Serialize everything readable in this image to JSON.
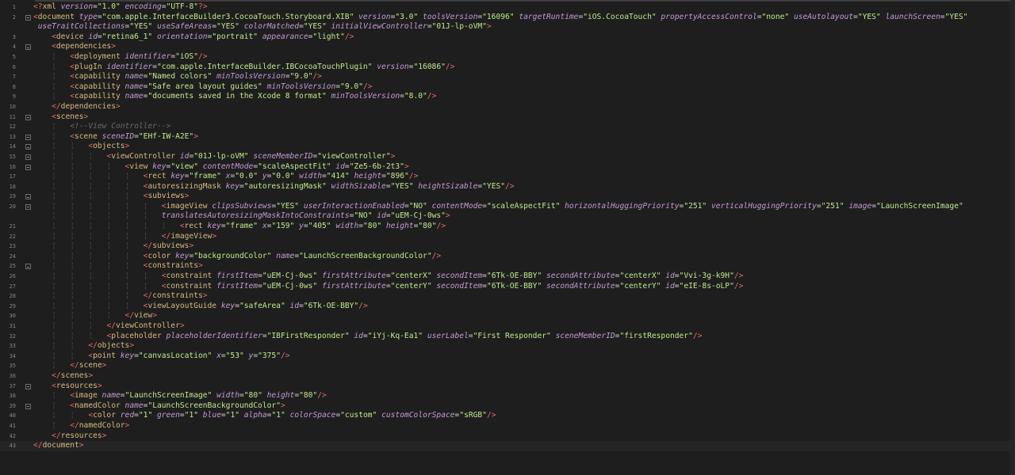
{
  "editor": {
    "lines": [
      {
        "n": "1",
        "fold": false,
        "indent": 1,
        "html": "<span class='punc'>&lt;?</span><span class='tag'>xml</span> <span class='attr'>version</span>=<span class='val'>\"1.0\"</span> <span class='attr'>encoding</span>=<span class='val'>\"UTF-8\"</span><span class='punc'>?&gt;</span>"
      },
      {
        "n": "2",
        "fold": true,
        "indent": 0,
        "html": "<span class='punc'>&lt;</span><span class='tag'>document</span> <span class='attr'>type</span>=<span class='val'>\"com.apple.InterfaceBuilder3.CocoaTouch.Storyboard.XIB\"</span> <span class='attr'>version</span>=<span class='val'>\"3.0\"</span> <span class='attr'>toolsVersion</span>=<span class='val'>\"16096\"</span> <span class='attr'>targetRuntime</span>=<span class='val'>\"iOS.CocoaTouch\"</span> <span class='attr'>propertyAccessControl</span>=<span class='val'>\"none\"</span> <span class='attr'>useAutolayout</span>=<span class='val'>\"YES\"</span> <span class='attr'>launchScreen</span>=<span class='val'>\"YES\"</span>"
      },
      {
        "n": "",
        "fold": false,
        "indent": 0,
        "cont": true,
        "html": " <span class='attr'>useTraitCollections</span>=<span class='val'>\"YES\"</span> <span class='attr'>useSafeAreas</span>=<span class='val'>\"YES\"</span> <span class='attr'>colorMatched</span>=<span class='val'>\"YES\"</span> <span class='attr'>initialViewController</span>=<span class='val'>\"01J-lp-oVM\"</span><span class='punc'>&gt;</span>"
      },
      {
        "n": "3",
        "fold": false,
        "indent": 1,
        "html": "    <span class='punc'>&lt;</span><span class='tag'>device</span> <span class='attr'>id</span>=<span class='val'>\"retina6_1\"</span> <span class='attr'>orientation</span>=<span class='val'>\"portrait\"</span> <span class='attr'>appearance</span>=<span class='val'>\"light\"</span><span class='punc'>/&gt;</span>"
      },
      {
        "n": "4",
        "fold": true,
        "indent": 1,
        "html": "    <span class='punc'>&lt;</span><span class='tag'>dependencies</span><span class='punc'>&gt;</span>"
      },
      {
        "n": "5",
        "fold": false,
        "indent": 2,
        "html": "    <span class='guide'>¦</span>   <span class='punc'>&lt;</span><span class='tag'>deployment</span> <span class='attr'>identifier</span>=<span class='val'>\"iOS\"</span><span class='punc'>/&gt;</span>"
      },
      {
        "n": "6",
        "fold": false,
        "indent": 2,
        "html": "    <span class='guide'>¦</span>   <span class='punc'>&lt;</span><span class='tag'>plugIn</span> <span class='attr'>identifier</span>=<span class='val'>\"com.apple.InterfaceBuilder.IBCocoaTouchPlugin\"</span> <span class='attr'>version</span>=<span class='val'>\"16086\"</span><span class='punc'>/&gt;</span>"
      },
      {
        "n": "7",
        "fold": false,
        "indent": 2,
        "html": "    <span class='guide'>¦</span>   <span class='punc'>&lt;</span><span class='tag'>capability</span> <span class='attr'>name</span>=<span class='val'>\"Named colors\"</span> <span class='attr'>minToolsVersion</span>=<span class='val'>\"9.0\"</span><span class='punc'>/&gt;</span>"
      },
      {
        "n": "8",
        "fold": false,
        "indent": 2,
        "html": "    <span class='guide'>¦</span>   <span class='punc'>&lt;</span><span class='tag'>capability</span> <span class='attr'>name</span>=<span class='val'>\"Safe area layout guides\"</span> <span class='attr'>minToolsVersion</span>=<span class='val'>\"9.0\"</span><span class='punc'>/&gt;</span>"
      },
      {
        "n": "9",
        "fold": false,
        "indent": 2,
        "html": "    <span class='guide'>¦</span>   <span class='punc'>&lt;</span><span class='tag'>capability</span> <span class='attr'>name</span>=<span class='val'>\"documents saved in the Xcode 8 format\"</span> <span class='attr'>minToolsVersion</span>=<span class='val'>\"8.0\"</span><span class='punc'>/&gt;</span>"
      },
      {
        "n": "10",
        "fold": false,
        "indent": 1,
        "html": "    <span class='punc'>&lt;/</span><span class='tag'>dependencies</span><span class='punc'>&gt;</span>"
      },
      {
        "n": "11",
        "fold": true,
        "indent": 1,
        "html": "    <span class='punc'>&lt;</span><span class='tag'>scenes</span><span class='punc'>&gt;</span>"
      },
      {
        "n": "12",
        "fold": false,
        "indent": 2,
        "html": "    <span class='guide'>¦</span>   <span class='cmt'>&lt;!--View Controller--&gt;</span>"
      },
      {
        "n": "13",
        "fold": true,
        "indent": 2,
        "html": "    <span class='guide'>¦</span>   <span class='punc'>&lt;</span><span class='tag'>scene</span> <span class='attr'>sceneID</span>=<span class='val'>\"EHf-IW-A2E\"</span><span class='punc'>&gt;</span>"
      },
      {
        "n": "14",
        "fold": true,
        "indent": 3,
        "html": "    <span class='guide'>¦</span>   <span class='guide'>¦</span>   <span class='punc'>&lt;</span><span class='tag'>objects</span><span class='punc'>&gt;</span>"
      },
      {
        "n": "15",
        "fold": true,
        "indent": 4,
        "html": "    <span class='guide'>¦</span>   <span class='guide'>¦</span>   <span class='guide'>¦</span>   <span class='punc'>&lt;</span><span class='tag'>viewController</span> <span class='attr'>id</span>=<span class='val'>\"01J-lp-oVM\"</span> <span class='attr'>sceneMemberID</span>=<span class='val'>\"viewController\"</span><span class='punc'>&gt;</span>"
      },
      {
        "n": "16",
        "fold": true,
        "indent": 5,
        "html": "    <span class='guide'>¦</span>   <span class='guide'>¦</span>   <span class='guide'>¦</span>   <span class='guide'>¦</span>   <span class='punc'>&lt;</span><span class='tag'>view</span> <span class='attr'>key</span>=<span class='val'>\"view\"</span> <span class='attr'>contentMode</span>=<span class='val'>\"scaleAspectFit\"</span> <span class='attr'>id</span>=<span class='val'>\"Ze5-6b-2t3\"</span><span class='punc'>&gt;</span>"
      },
      {
        "n": "17",
        "fold": false,
        "indent": 6,
        "html": "    <span class='guide'>¦</span>   <span class='guide'>¦</span>   <span class='guide'>¦</span>   <span class='guide'>¦</span>   <span class='guide'>¦</span>   <span class='punc'>&lt;</span><span class='tag'>rect</span> <span class='attr'>key</span>=<span class='val'>\"frame\"</span> <span class='attr'>x</span>=<span class='val'>\"0.0\"</span> <span class='attr'>y</span>=<span class='val'>\"0.0\"</span> <span class='attr'>width</span>=<span class='val'>\"414\"</span> <span class='attr'>height</span>=<span class='val'>\"896\"</span><span class='punc'>/&gt;</span>"
      },
      {
        "n": "18",
        "fold": false,
        "indent": 6,
        "html": "    <span class='guide'>¦</span>   <span class='guide'>¦</span>   <span class='guide'>¦</span>   <span class='guide'>¦</span>   <span class='guide'>¦</span>   <span class='punc'>&lt;</span><span class='tag'>autoresizingMask</span> <span class='attr'>key</span>=<span class='val'>\"autoresizingMask\"</span> <span class='attr'>widthSizable</span>=<span class='val'>\"YES\"</span> <span class='attr'>heightSizable</span>=<span class='val'>\"YES\"</span><span class='punc'>/&gt;</span>"
      },
      {
        "n": "19",
        "fold": true,
        "indent": 6,
        "html": "    <span class='guide'>¦</span>   <span class='guide'>¦</span>   <span class='guide'>¦</span>   <span class='guide'>¦</span>   <span class='guide'>¦</span>   <span class='punc'>&lt;</span><span class='tag'>subviews</span><span class='punc'>&gt;</span>"
      },
      {
        "n": "20",
        "fold": true,
        "indent": 7,
        "html": "    <span class='guide'>¦</span>   <span class='guide'>¦</span>   <span class='guide'>¦</span>   <span class='guide'>¦</span>   <span class='guide'>¦</span>   <span class='guide'>¦</span>   <span class='punc'>&lt;</span><span class='tag'>imageView</span> <span class='attr'>clipsSubviews</span>=<span class='val'>\"YES\"</span> <span class='attr'>userInteractionEnabled</span>=<span class='val'>\"NO\"</span> <span class='attr'>contentMode</span>=<span class='val'>\"scaleAspectFit\"</span> <span class='attr'>horizontalHuggingPriority</span>=<span class='val'>\"251\"</span> <span class='attr'>verticalHuggingPriority</span>=<span class='val'>\"251\"</span> <span class='attr'>image</span>=<span class='val'>\"LaunchScreenImage\"</span>"
      },
      {
        "n": "",
        "fold": false,
        "indent": 7,
        "cont": true,
        "html": "    <span class='guide'>¦</span>   <span class='guide'>¦</span>   <span class='guide'>¦</span>   <span class='guide'>¦</span>   <span class='guide'>¦</span>   <span class='guide'>¦</span>   <span class='attr'>translatesAutoresizingMaskIntoConstraints</span>=<span class='val'>\"NO\"</span> <span class='attr'>id</span>=<span class='val'>\"uEM-Cj-0ws\"</span><span class='punc'>&gt;</span>"
      },
      {
        "n": "21",
        "fold": false,
        "indent": 8,
        "html": "    <span class='guide'>¦</span>   <span class='guide'>¦</span>   <span class='guide'>¦</span>   <span class='guide'>¦</span>   <span class='guide'>¦</span>   <span class='guide'>¦</span>   <span class='guide'>¦</span>   <span class='punc'>&lt;</span><span class='tag'>rect</span> <span class='attr'>key</span>=<span class='val'>\"frame\"</span> <span class='attr'>x</span>=<span class='val'>\"159\"</span> <span class='attr'>y</span>=<span class='val'>\"405\"</span> <span class='attr'>width</span>=<span class='val'>\"80\"</span> <span class='attr'>height</span>=<span class='val'>\"80\"</span><span class='punc'>/&gt;</span>"
      },
      {
        "n": "22",
        "fold": false,
        "indent": 7,
        "html": "    <span class='guide'>¦</span>   <span class='guide'>¦</span>   <span class='guide'>¦</span>   <span class='guide'>¦</span>   <span class='guide'>¦</span>   <span class='guide'>¦</span>   <span class='punc'>&lt;/</span><span class='tag'>imageView</span><span class='punc'>&gt;</span>"
      },
      {
        "n": "23",
        "fold": false,
        "indent": 6,
        "html": "    <span class='guide'>¦</span>   <span class='guide'>¦</span>   <span class='guide'>¦</span>   <span class='guide'>¦</span>   <span class='guide'>¦</span>   <span class='punc'>&lt;/</span><span class='tag'>subviews</span><span class='punc'>&gt;</span>"
      },
      {
        "n": "24",
        "fold": false,
        "indent": 6,
        "html": "    <span class='guide'>¦</span>   <span class='guide'>¦</span>   <span class='guide'>¦</span>   <span class='guide'>¦</span>   <span class='guide'>¦</span>   <span class='punc'>&lt;</span><span class='tag'>color</span> <span class='attr'>key</span>=<span class='val'>\"backgroundColor\"</span> <span class='attr'>name</span>=<span class='val'>\"LaunchScreenBackgroundColor\"</span><span class='punc'>/&gt;</span>"
      },
      {
        "n": "25",
        "fold": true,
        "indent": 6,
        "html": "    <span class='guide'>¦</span>   <span class='guide'>¦</span>   <span class='guide'>¦</span>   <span class='guide'>¦</span>   <span class='guide'>¦</span>   <span class='punc'>&lt;</span><span class='tag'>constraints</span><span class='punc'>&gt;</span>"
      },
      {
        "n": "26",
        "fold": false,
        "indent": 7,
        "html": "    <span class='guide'>¦</span>   <span class='guide'>¦</span>   <span class='guide'>¦</span>   <span class='guide'>¦</span>   <span class='guide'>¦</span>   <span class='guide'>¦</span>   <span class='punc'>&lt;</span><span class='tag'>constraint</span> <span class='attr'>firstItem</span>=<span class='val'>\"uEM-Cj-0ws\"</span> <span class='attr'>firstAttribute</span>=<span class='val'>\"centerX\"</span> <span class='attr'>secondItem</span>=<span class='val'>\"6Tk-OE-BBY\"</span> <span class='attr'>secondAttribute</span>=<span class='val'>\"centerX\"</span> <span class='attr'>id</span>=<span class='val'>\"Vvi-3g-k9H\"</span><span class='punc'>/&gt;</span>"
      },
      {
        "n": "27",
        "fold": false,
        "indent": 7,
        "html": "    <span class='guide'>¦</span>   <span class='guide'>¦</span>   <span class='guide'>¦</span>   <span class='guide'>¦</span>   <span class='guide'>¦</span>   <span class='guide'>¦</span>   <span class='punc'>&lt;</span><span class='tag'>constraint</span> <span class='attr'>firstItem</span>=<span class='val'>\"uEM-Cj-0ws\"</span> <span class='attr'>firstAttribute</span>=<span class='val'>\"centerY\"</span> <span class='attr'>secondItem</span>=<span class='val'>\"6Tk-OE-BBY\"</span> <span class='attr'>secondAttribute</span>=<span class='val'>\"centerY\"</span> <span class='attr'>id</span>=<span class='val'>\"eIE-8s-oLP\"</span><span class='punc'>/&gt;</span>"
      },
      {
        "n": "28",
        "fold": false,
        "indent": 6,
        "html": "    <span class='guide'>¦</span>   <span class='guide'>¦</span>   <span class='guide'>¦</span>   <span class='guide'>¦</span>   <span class='guide'>¦</span>   <span class='punc'>&lt;/</span><span class='tag'>constraints</span><span class='punc'>&gt;</span>"
      },
      {
        "n": "29",
        "fold": false,
        "indent": 6,
        "html": "    <span class='guide'>¦</span>   <span class='guide'>¦</span>   <span class='guide'>¦</span>   <span class='guide'>¦</span>   <span class='guide'>¦</span>   <span class='punc'>&lt;</span><span class='tag'>viewLayoutGuide</span> <span class='attr'>key</span>=<span class='val'>\"safeArea\"</span> <span class='attr'>id</span>=<span class='val'>\"6Tk-OE-BBY\"</span><span class='punc'>/&gt;</span>"
      },
      {
        "n": "30",
        "fold": false,
        "indent": 5,
        "html": "    <span class='guide'>¦</span>   <span class='guide'>¦</span>   <span class='guide'>¦</span>   <span class='guide'>¦</span>   <span class='punc'>&lt;/</span><span class='tag'>view</span><span class='punc'>&gt;</span>"
      },
      {
        "n": "31",
        "fold": false,
        "indent": 4,
        "html": "    <span class='guide'>¦</span>   <span class='guide'>¦</span>   <span class='guide'>¦</span>   <span class='punc'>&lt;/</span><span class='tag'>viewController</span><span class='punc'>&gt;</span>"
      },
      {
        "n": "32",
        "fold": false,
        "indent": 4,
        "html": "    <span class='guide'>¦</span>   <span class='guide'>¦</span>   <span class='guide'>¦</span>   <span class='punc'>&lt;</span><span class='tag'>placeholder</span> <span class='attr'>placeholderIdentifier</span>=<span class='val'>\"IBFirstResponder\"</span> <span class='attr'>id</span>=<span class='val'>\"iYj-Kq-Ea1\"</span> <span class='attr'>userLabel</span>=<span class='val'>\"First Responder\"</span> <span class='attr'>sceneMemberID</span>=<span class='val'>\"firstResponder\"</span><span class='punc'>/&gt;</span>"
      },
      {
        "n": "33",
        "fold": false,
        "indent": 3,
        "html": "    <span class='guide'>¦</span>   <span class='guide'>¦</span>   <span class='punc'>&lt;/</span><span class='tag'>objects</span><span class='punc'>&gt;</span>"
      },
      {
        "n": "34",
        "fold": false,
        "indent": 3,
        "html": "    <span class='guide'>¦</span>   <span class='guide'>¦</span>   <span class='punc'>&lt;</span><span class='tag'>point</span> <span class='attr'>key</span>=<span class='val'>\"canvasLocation\"</span> <span class='attr'>x</span>=<span class='val'>\"53\"</span> <span class='attr'>y</span>=<span class='val'>\"375\"</span><span class='punc'>/&gt;</span>"
      },
      {
        "n": "35",
        "fold": false,
        "indent": 2,
        "html": "    <span class='guide'>¦</span>   <span class='punc'>&lt;/</span><span class='tag'>scene</span><span class='punc'>&gt;</span>"
      },
      {
        "n": "36",
        "fold": false,
        "indent": 1,
        "html": "    <span class='punc'>&lt;/</span><span class='tag'>scenes</span><span class='punc'>&gt;</span>"
      },
      {
        "n": "37",
        "fold": true,
        "indent": 1,
        "html": "    <span class='punc'>&lt;</span><span class='tag'>resources</span><span class='punc'>&gt;</span>"
      },
      {
        "n": "38",
        "fold": false,
        "indent": 2,
        "html": "    <span class='guide'>¦</span>   <span class='punc'>&lt;</span><span class='tag'>image</span> <span class='attr'>name</span>=<span class='val'>\"LaunchScreenImage\"</span> <span class='attr'>width</span>=<span class='val'>\"80\"</span> <span class='attr'>height</span>=<span class='val'>\"80\"</span><span class='punc'>/&gt;</span>"
      },
      {
        "n": "39",
        "fold": true,
        "indent": 2,
        "html": "    <span class='guide'>¦</span>   <span class='punc'>&lt;</span><span class='tag'>namedColor</span> <span class='attr'>name</span>=<span class='val'>\"LaunchScreenBackgroundColor\"</span><span class='punc'>&gt;</span>"
      },
      {
        "n": "40",
        "fold": false,
        "indent": 3,
        "html": "    <span class='guide'>¦</span>   <span class='guide'>¦</span>   <span class='punc'>&lt;</span><span class='tag'>color</span> <span class='attr'>red</span>=<span class='val'>\"1\"</span> <span class='attr'>green</span>=<span class='val'>\"1\"</span> <span class='attr'>blue</span>=<span class='val'>\"1\"</span> <span class='attr'>alpha</span>=<span class='val'>\"1\"</span> <span class='attr'>colorSpace</span>=<span class='val'>\"custom\"</span> <span class='attr'>customColorSpace</span>=<span class='val'>\"sRGB\"</span><span class='punc'>/&gt;</span>"
      },
      {
        "n": "41",
        "fold": false,
        "indent": 2,
        "html": "    <span class='guide'>¦</span>   <span class='punc'>&lt;/</span><span class='tag'>namedColor</span><span class='punc'>&gt;</span>"
      },
      {
        "n": "42",
        "fold": false,
        "indent": 1,
        "html": "    <span class='punc'>&lt;/</span><span class='tag'>resources</span><span class='punc'>&gt;</span>"
      },
      {
        "n": "43",
        "fold": false,
        "indent": 0,
        "cursor": true,
        "html": "<span class='punc'>&lt;/</span><span class='tag'>document</span><span class='punc'>&gt;</span>"
      }
    ]
  }
}
